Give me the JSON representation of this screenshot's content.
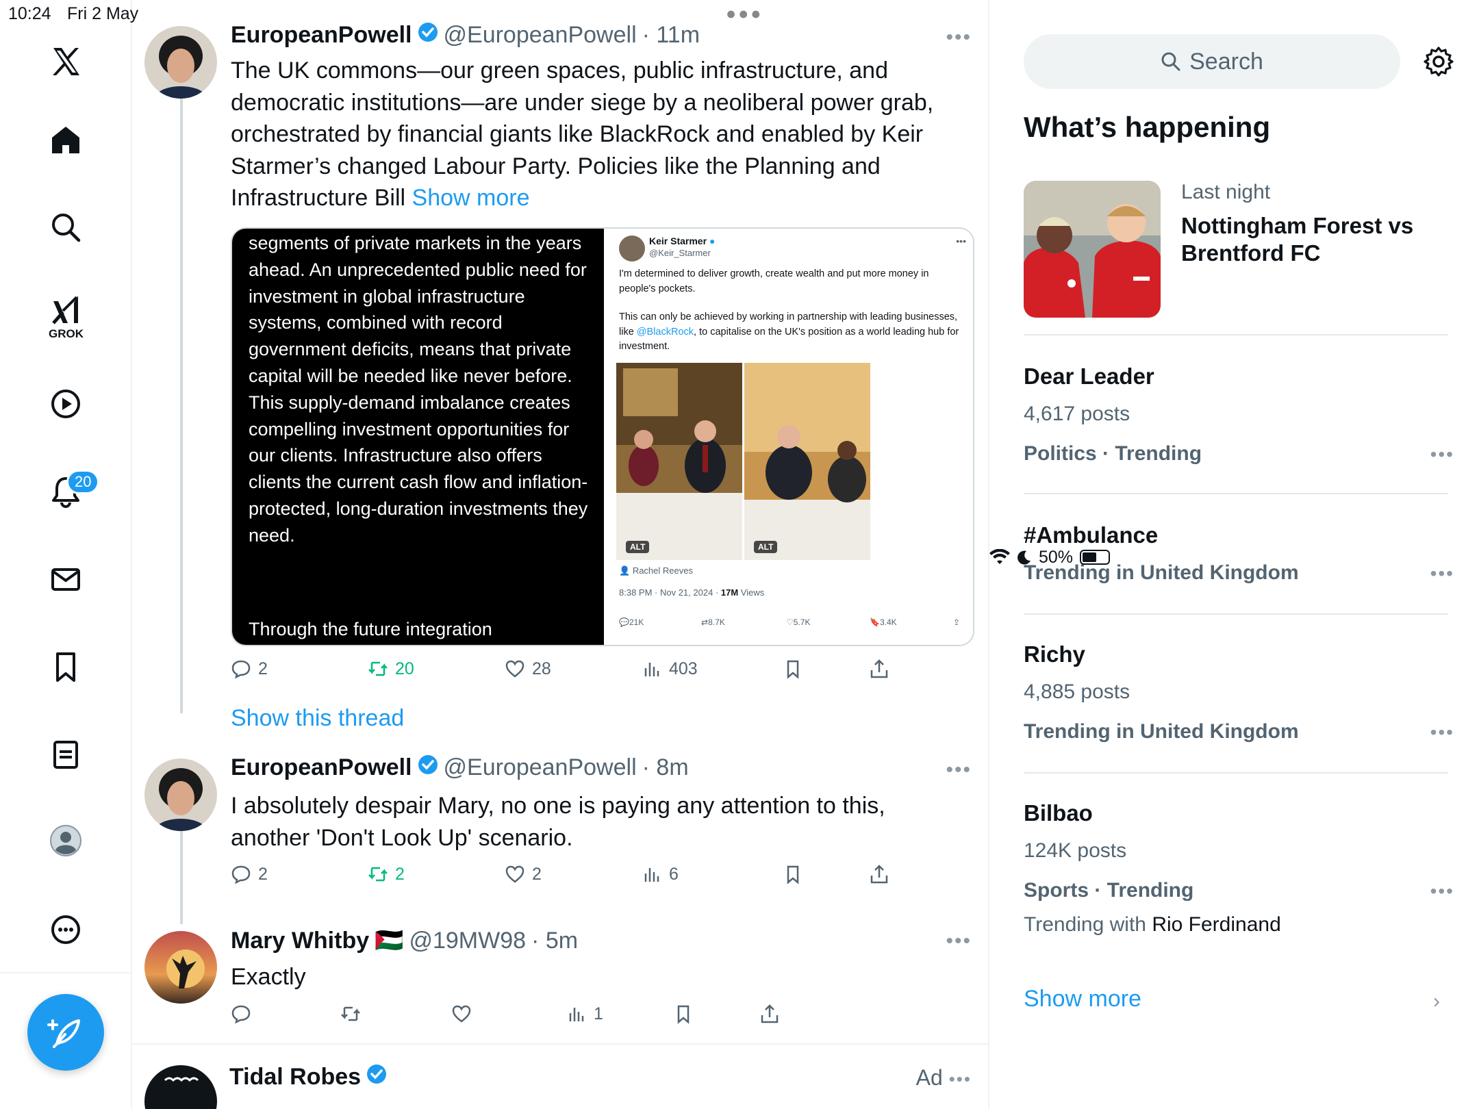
{
  "status_bar": {
    "time": "10:24",
    "date": "Fri 2 May",
    "battery": "50%",
    "battery_level": 0.5
  },
  "nav": {
    "grok_label": "GROK",
    "notifications_count": "20"
  },
  "tweets": [
    {
      "name": "EuropeanPowell",
      "handle": "@EuropeanPowell",
      "time": "· 11m",
      "text": "The UK commons—our green spaces, public infrastructure, and democratic institutions—are under siege by a neoliberal power grab, orchestrated by financial giants like BlackRock and enabled by Keir Starmer’s changed Labour Party. Policies like the Planning and Infrastructure Bill",
      "show_more": "Show more",
      "replies": "2",
      "retweets": "20",
      "likes": "28",
      "views": "403"
    },
    {
      "name": "EuropeanPowell",
      "handle": "@EuropeanPowell",
      "time": "· 8m",
      "text": "I absolutely despair Mary, no one is paying any attention to this, another 'Don't Look Up' scenario.",
      "replies": "2",
      "retweets": "2",
      "likes": "2",
      "views": "6"
    },
    {
      "name": "Mary Whitby",
      "flag": "🇵🇸",
      "handle": "@19MW98",
      "time": "· 5m",
      "text": "Exactly",
      "views": "1"
    }
  ],
  "media": {
    "left_text": "segments of private markets in the years ahead. An unprecedented public need for investment in global infrastructure systems, combined with record government deficits, means that private capital will be needed like never before. This supply-demand imbalance creates compelling investment opportunities for our clients. Infrastructure also offers clients the current cash flow and inflation-protected, long-duration investments they need.",
    "left_text_2": "Through the future integration",
    "quoted": {
      "name": "Keir Starmer",
      "handle": "@Keir_Starmer",
      "text_1": "I'm determined to deliver growth, create wealth and put more money in people's pockets.",
      "text_2a": "This can only be achieved by working in partnership with leading businesses, like ",
      "text_2_link": "@BlackRock",
      "text_2b": ", to capitalise on the UK's position as a world leading hub for investment.",
      "alt": "ALT",
      "credit": "Rachel Reeves",
      "meta": "8:38 PM · Nov 21, 2024 · ",
      "views": "17M",
      "views_label": " Views",
      "replies": "21K",
      "retweets": "8.7K",
      "likes": "5.7K",
      "bookmarks": "3.4K"
    }
  },
  "show_thread": "Show this thread",
  "ad_tweet": {
    "name": "Tidal Robes",
    "ad_label": "Ad"
  },
  "right": {
    "search_placeholder": "Search",
    "section_title": "What’s happening",
    "trends": [
      {
        "sub": "Last night",
        "title": "Nottingham Forest vs Brentford FC"
      },
      {
        "title": "Dear Leader",
        "posts": "4,617 posts",
        "category": "Politics · Trending"
      },
      {
        "title": "#Ambulance",
        "category": "Trending in United Kingdom"
      },
      {
        "title": "Richy",
        "posts": "4,885 posts",
        "category": "Trending in United Kingdom"
      },
      {
        "title": "Bilbao",
        "posts": "124K posts",
        "category": "Sports · Trending",
        "with_label": "Trending with ",
        "with_name": "Rio Ferdinand"
      }
    ],
    "show_more": "Show more"
  },
  "colors": {
    "accent": "#1d9bf0",
    "retweet": "#00ba7c",
    "muted": "#536471"
  }
}
